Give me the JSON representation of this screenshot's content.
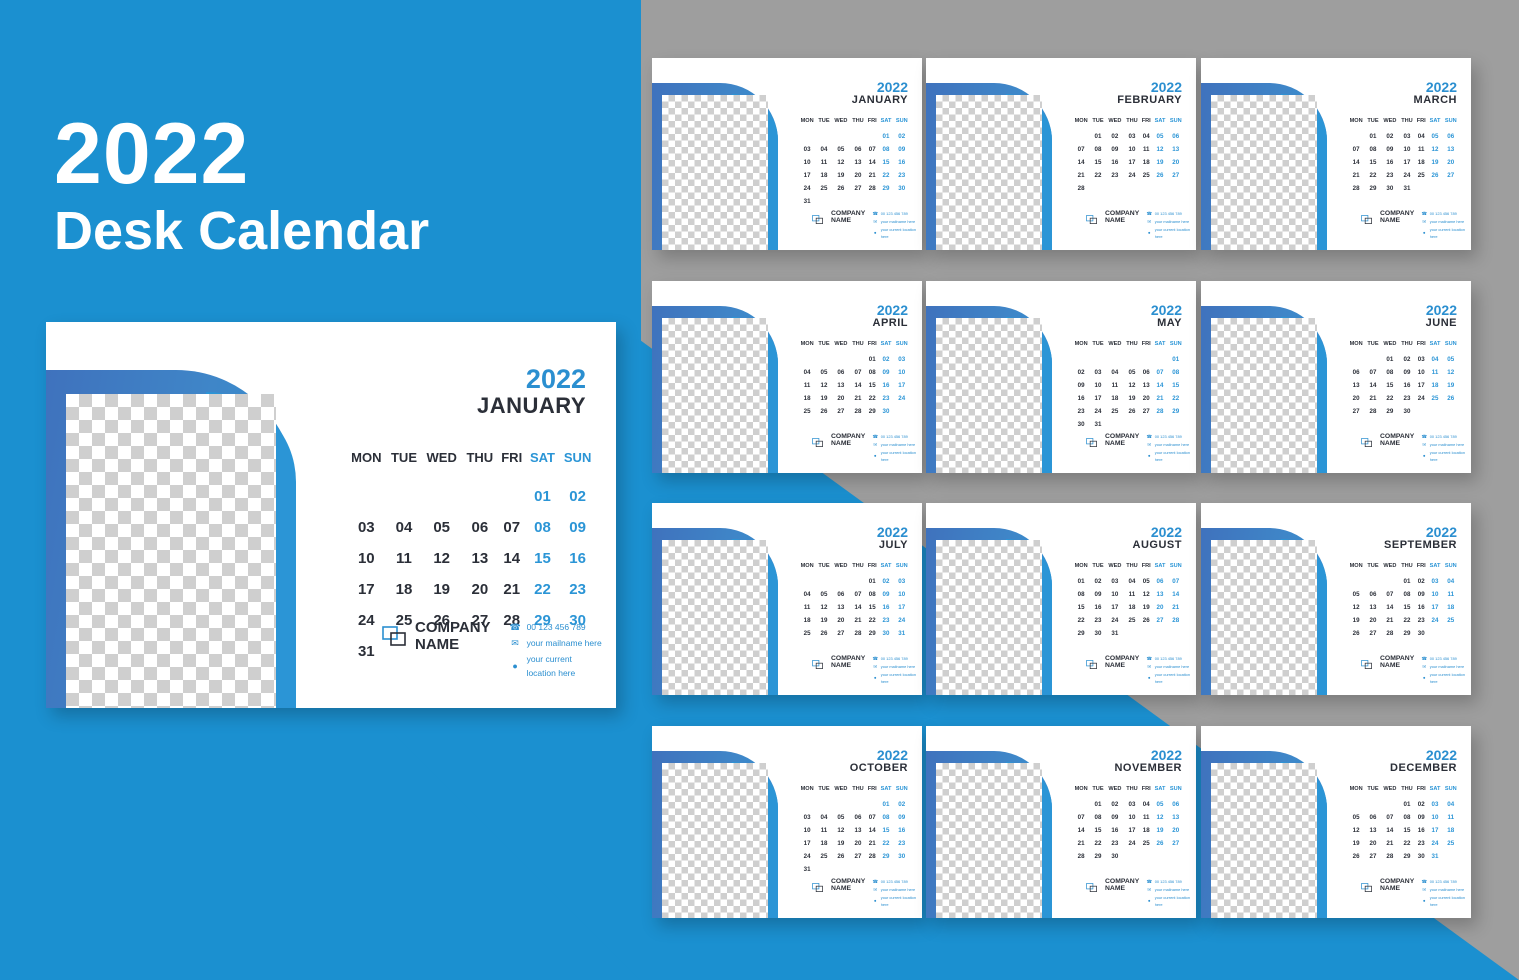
{
  "hero": {
    "year": "2022",
    "subtitle": "Desk Calendar"
  },
  "theme": {
    "background_blue": "#1b90d0",
    "background_gray": "#9e9e9e",
    "accent_blue": "#2b8fd0",
    "swoosh_dark_blue": "#3f72bd",
    "swoosh_light_blue": "#2b95d6",
    "text_dark": "#2b2f38",
    "card_white": "#ffffff"
  },
  "weekdays": [
    "MON",
    "TUE",
    "WED",
    "THU",
    "FRI",
    "SAT",
    "SUN"
  ],
  "company": {
    "name_line1": "COMPANY",
    "name_line2": "NAME",
    "logo_icon": "overlapping-squares-icon",
    "contacts": [
      {
        "icon": "phone-icon",
        "text": "00 123 456 789"
      },
      {
        "icon": "envelope-icon",
        "text": "your mailname here"
      },
      {
        "icon": "location-pin-icon",
        "text": "your current location here"
      }
    ]
  },
  "featured": {
    "year": "2022",
    "month": "JANUARY",
    "lead_blanks": 5,
    "days": 31
  },
  "months": [
    {
      "year": "2022",
      "month": "JANUARY",
      "lead_blanks": 5,
      "days": 31
    },
    {
      "year": "2022",
      "month": "FEBRUARY",
      "lead_blanks": 1,
      "days": 28
    },
    {
      "year": "2022",
      "month": "MARCH",
      "lead_blanks": 1,
      "days": 31
    },
    {
      "year": "2022",
      "month": "APRIL",
      "lead_blanks": 4,
      "days": 30
    },
    {
      "year": "2022",
      "month": "MAY",
      "lead_blanks": 6,
      "days": 31
    },
    {
      "year": "2022",
      "month": "JUNE",
      "lead_blanks": 2,
      "days": 30
    },
    {
      "year": "2022",
      "month": "JULY",
      "lead_blanks": 4,
      "days": 31
    },
    {
      "year": "2022",
      "month": "AUGUST",
      "lead_blanks": 0,
      "days": 31
    },
    {
      "year": "2022",
      "month": "SEPTEMBER",
      "lead_blanks": 3,
      "days": 30
    },
    {
      "year": "2022",
      "month": "OCTOBER",
      "lead_blanks": 5,
      "days": 31
    },
    {
      "year": "2022",
      "month": "NOVEMBER",
      "lead_blanks": 1,
      "days": 30
    },
    {
      "year": "2022",
      "month": "DECEMBER",
      "lead_blanks": 3,
      "days": 31
    }
  ],
  "thumb_layout": {
    "left_positions": [
      652,
      926,
      1201
    ],
    "top_positions": [
      58,
      281,
      503,
      726
    ]
  }
}
